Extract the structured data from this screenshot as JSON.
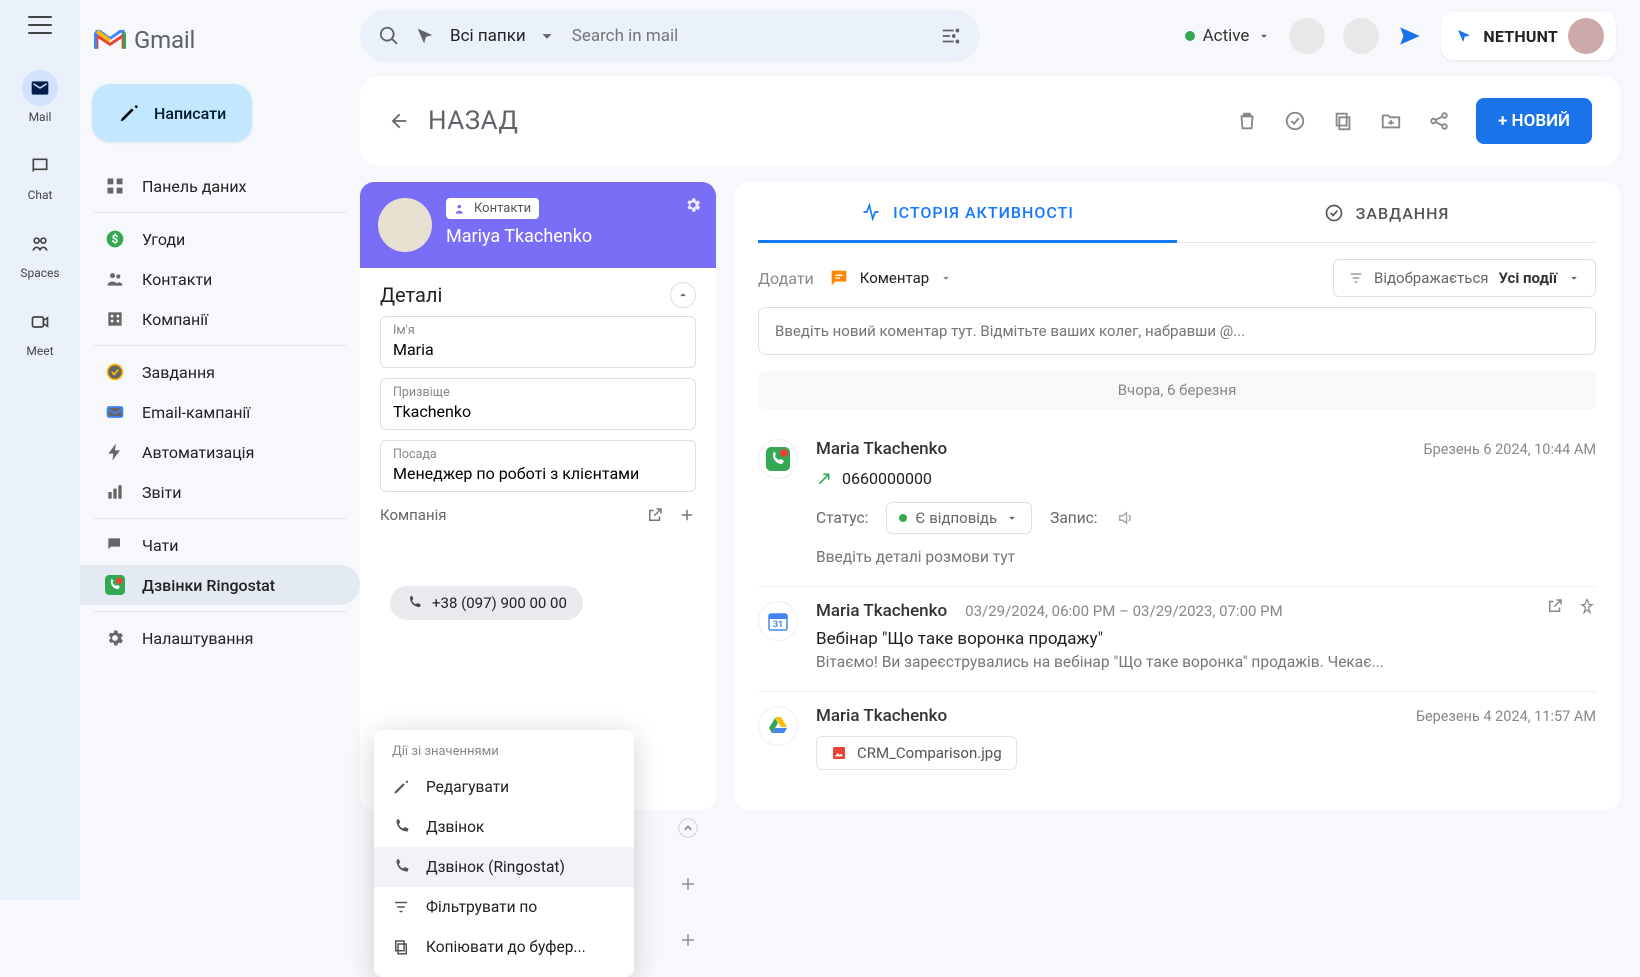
{
  "app": {
    "name": "Gmail"
  },
  "rail": {
    "mail": "Mail",
    "chat": "Chat",
    "spaces": "Spaces",
    "meet": "Meet"
  },
  "compose": "Написати",
  "sidebar": {
    "items": [
      {
        "label": "Панель даних"
      },
      {
        "label": "Угоди"
      },
      {
        "label": "Контакти"
      },
      {
        "label": "Компанії"
      },
      {
        "label": "Завдання"
      },
      {
        "label": "Email-кампанії"
      },
      {
        "label": "Автоматизація"
      },
      {
        "label": "Звіти"
      },
      {
        "label": "Чати"
      },
      {
        "label": "Дзвінки Ringostat"
      },
      {
        "label": "Налаштування"
      }
    ]
  },
  "search": {
    "scope": "Всі папки",
    "placeholder": "Search in mail"
  },
  "status": "Active",
  "brand": "NETHUNT",
  "header": {
    "back": "НАЗАД",
    "new": "+ НОВИЙ"
  },
  "contact": {
    "badge": "Контакти",
    "name": "Mariya Tkachenko",
    "section": "Деталі",
    "fields": {
      "firstname_label": "Ім'я",
      "firstname": "Maria",
      "lastname_label": "Призвіще",
      "lastname": "Tkachenko",
      "title_label": "Посада",
      "title": "Менеджер по роботі з клієнтами"
    },
    "company_label": "Компанія",
    "phone": "+38 (097) 900 00 00"
  },
  "ctx": {
    "title": "Дії зі значеннями",
    "edit": "Редагувати",
    "call": "Дзвінок",
    "call_ringostat": "Дзвінок (Ringostat)",
    "filter": "Фільтрувати по",
    "copy": "Копіювати до буфер..."
  },
  "timeline": {
    "tabs": {
      "activity": "ІСТОРІЯ АКТИВНОСТІ",
      "tasks": "ЗАВДАННЯ"
    },
    "add_label": "Додати",
    "comment_label": "Коментар",
    "filter_prefix": "Відображається",
    "filter_value": "Усі події",
    "comment_placeholder": "Введіть новий коментар тут. Відмітьте ваших колег, набравши @...",
    "day": "Вчора, 6 березня",
    "call": {
      "name": "Maria Tkachenko",
      "date": "Брезень 6 2024, 10:44 AM",
      "phone": "0660000000",
      "status_label": "Статус:",
      "status_value": "Є відповідь",
      "record_label": "Запис:",
      "note_placeholder": "Введіть деталі розмови тут"
    },
    "event2": {
      "name": "Maria Tkachenko",
      "when": "03/29/2024, 06:00 PM – 03/29/2023, 07:00 PM",
      "title": "Вебінар \"Що таке воронка продажу\"",
      "desc": "Вітаємо! Ви зареєструвались на вебінар \"Що таке воронка\" продажів. Чекає..."
    },
    "event3": {
      "name": "Maria Tkachenko",
      "date": "Березень 4 2024, 11:57 AM",
      "file": "CRM_Comparison.jpg"
    }
  }
}
